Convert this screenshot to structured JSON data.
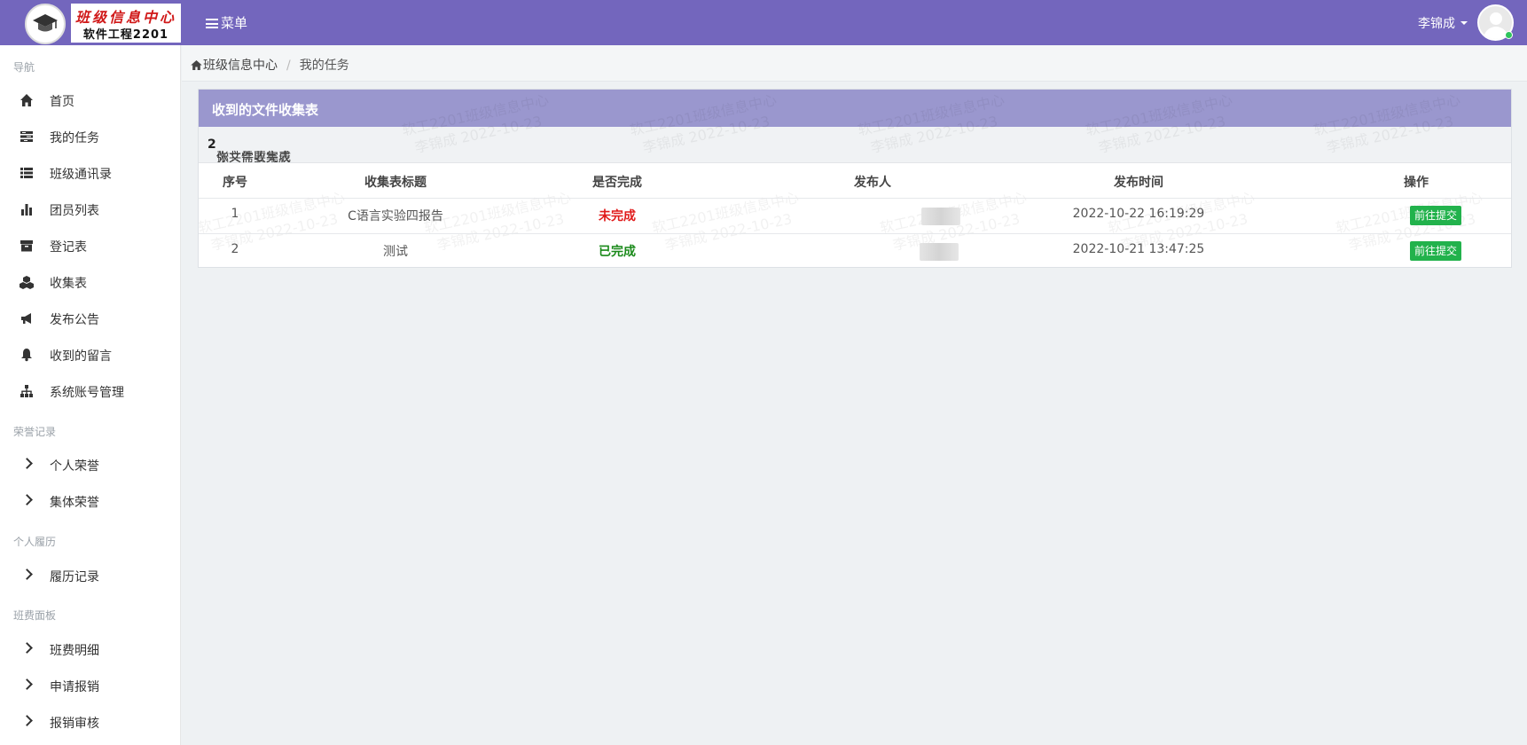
{
  "header": {
    "logo_line1": "班级信息中心",
    "logo_line2": "软件工程2201",
    "menu_label": "菜单",
    "user_name": "李锦成"
  },
  "sidebar": {
    "sections": [
      {
        "title": "导航",
        "items": [
          {
            "label": "首页",
            "icon": "home-icon"
          },
          {
            "label": "我的任务",
            "icon": "tasks-icon"
          },
          {
            "label": "班级通讯录",
            "icon": "list-icon"
          },
          {
            "label": "团员列表",
            "icon": "bar-chart-icon"
          },
          {
            "label": "登记表",
            "icon": "archive-icon"
          },
          {
            "label": "收集表",
            "icon": "cubes-icon"
          },
          {
            "label": "发布公告",
            "icon": "bullhorn-icon"
          },
          {
            "label": "收到的留言",
            "icon": "bell-icon"
          },
          {
            "label": "系统账号管理",
            "icon": "sitemap-icon"
          }
        ]
      },
      {
        "title": "荣誉记录",
        "items": [
          {
            "label": "个人荣誉",
            "icon": "chevron-right-icon"
          },
          {
            "label": "集体荣誉",
            "icon": "chevron-right-icon"
          }
        ]
      },
      {
        "title": "个人履历",
        "items": [
          {
            "label": "履历记录",
            "icon": "chevron-right-icon"
          }
        ]
      },
      {
        "title": "班费面板",
        "items": [
          {
            "label": "班费明细",
            "icon": "chevron-right-icon"
          },
          {
            "label": "申请报销",
            "icon": "chevron-right-icon"
          },
          {
            "label": "报销审核",
            "icon": "chevron-right-icon"
          }
        ]
      }
    ]
  },
  "breadcrumb": {
    "home": "班级信息中心",
    "current": "我的任务"
  },
  "panel": {
    "title": "收到的文件收集表",
    "info_prefix": "你共需要完成",
    "info_count": "2",
    "info_suffix": "张文件收集表",
    "watermark": [
      "软工2201班级信息中心",
      "李锦成 2022-10-23"
    ],
    "columns": [
      "序号",
      "收集表标题",
      "是否完成",
      "发布人",
      "发布时间",
      "操作"
    ],
    "rows": [
      {
        "index": "1",
        "title": "C语言实验四报告",
        "status": "未完成",
        "status_color": "#e01a1a",
        "publisher": "",
        "time": "2022-10-22 16:19:29",
        "action": "前往提交"
      },
      {
        "index": "2",
        "title": "测试",
        "status": "已完成",
        "status_color": "#1a8a1a",
        "publisher": "",
        "time": "2022-10-21 13:47:25",
        "action": "前往提交"
      }
    ]
  },
  "colors": {
    "topbar": "#7366bd",
    "panel_header": "#9a97ce",
    "button": "#22b24c"
  }
}
